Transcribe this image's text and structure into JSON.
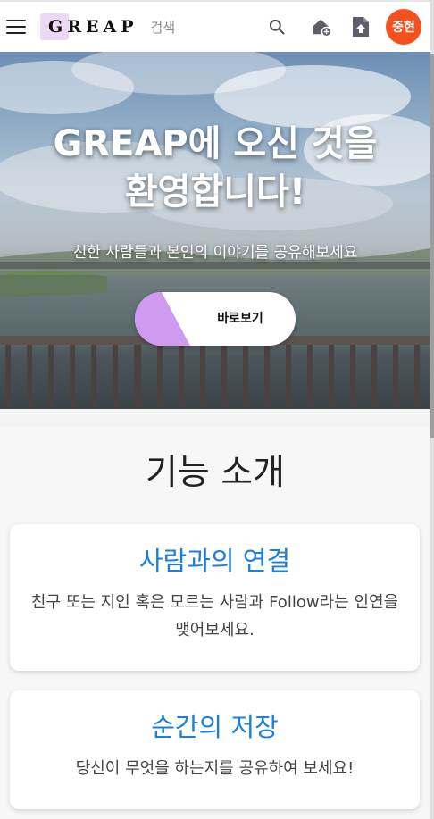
{
  "header": {
    "logo_text": "GREAP",
    "search_label": "검색",
    "avatar_label": "중현",
    "icons": [
      "menu-icon",
      "search-icon",
      "home-add-icon",
      "upload-file-icon"
    ],
    "avatar_color": "#f4511e"
  },
  "hero": {
    "title": "GREAP에 오신 것을\n환영합니다!",
    "subtitle": "친한 사람들과 본인의 이야기를 공유해보세요",
    "button_label": "바로보기",
    "button_accent_color": "#cf9bf1"
  },
  "features": {
    "title": "기능 소개",
    "cards": [
      {
        "title": "사람과의 연결",
        "description": "친구 또는 지인 혹은 모르는 사람과 Follow라는 인연을 맺어보세요."
      },
      {
        "title": "순간의 저장",
        "description": "당신이 무엇을 하는지를 공유하여 보세요!"
      }
    ],
    "title_color": "#1e7fd9"
  }
}
